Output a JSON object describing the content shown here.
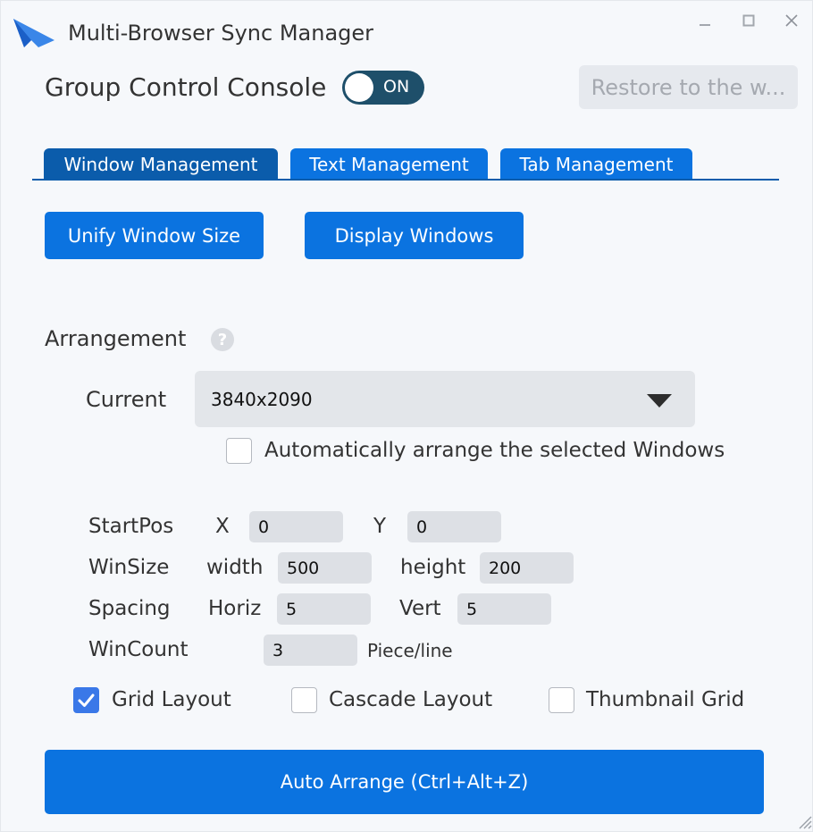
{
  "window": {
    "title": "Multi-Browser Sync Manager",
    "controls": {
      "minimize": "–",
      "maximize": "□",
      "close": "×"
    }
  },
  "console": {
    "title": "Group Control Console",
    "toggle_label": "ON",
    "toggle_on": true,
    "restore_button": "Restore to the w..."
  },
  "tabs": [
    {
      "label": "Window Management",
      "active": true
    },
    {
      "label": "Text Management",
      "active": false
    },
    {
      "label": "Tab Management",
      "active": false
    }
  ],
  "actions": {
    "unify_size": "Unify Window Size",
    "display_windows": "Display Windows"
  },
  "arrangement": {
    "label": "Arrangement",
    "help_icon": "?",
    "current_label": "Current",
    "current_value": "3840x2090",
    "auto_arrange_checkbox": {
      "label": "Automatically arrange the selected Windows",
      "checked": false
    }
  },
  "params": {
    "startpos": {
      "label": "StartPos",
      "x_label": "X",
      "x_value": "0",
      "y_label": "Y",
      "y_value": "0"
    },
    "winsize": {
      "label": "WinSize",
      "width_label": "width",
      "width_value": "500",
      "height_label": "height",
      "height_value": "200"
    },
    "spacing": {
      "label": "Spacing",
      "horiz_label": "Horiz",
      "horiz_value": "5",
      "vert_label": "Vert",
      "vert_value": "5"
    },
    "wincount": {
      "label": "WinCount",
      "value": "3",
      "unit": "Piece/line"
    }
  },
  "layouts": [
    {
      "label": "Grid Layout",
      "checked": true
    },
    {
      "label": "Cascade Layout",
      "checked": false
    },
    {
      "label": "Thumbnail Grid",
      "checked": false
    }
  ],
  "auto_arrange_button": "Auto Arrange (Ctrl+Alt+Z)",
  "colors": {
    "primary": "#0b73e0",
    "tab_active": "#0b5cab",
    "toggle_bg": "#1e4f6a",
    "checkbox_checked": "#3a78e8"
  },
  "icons": {
    "logo": "bird-logo-icon",
    "help": "question-circle-icon",
    "dropdown": "caret-down-icon",
    "check": "checkmark-icon"
  }
}
